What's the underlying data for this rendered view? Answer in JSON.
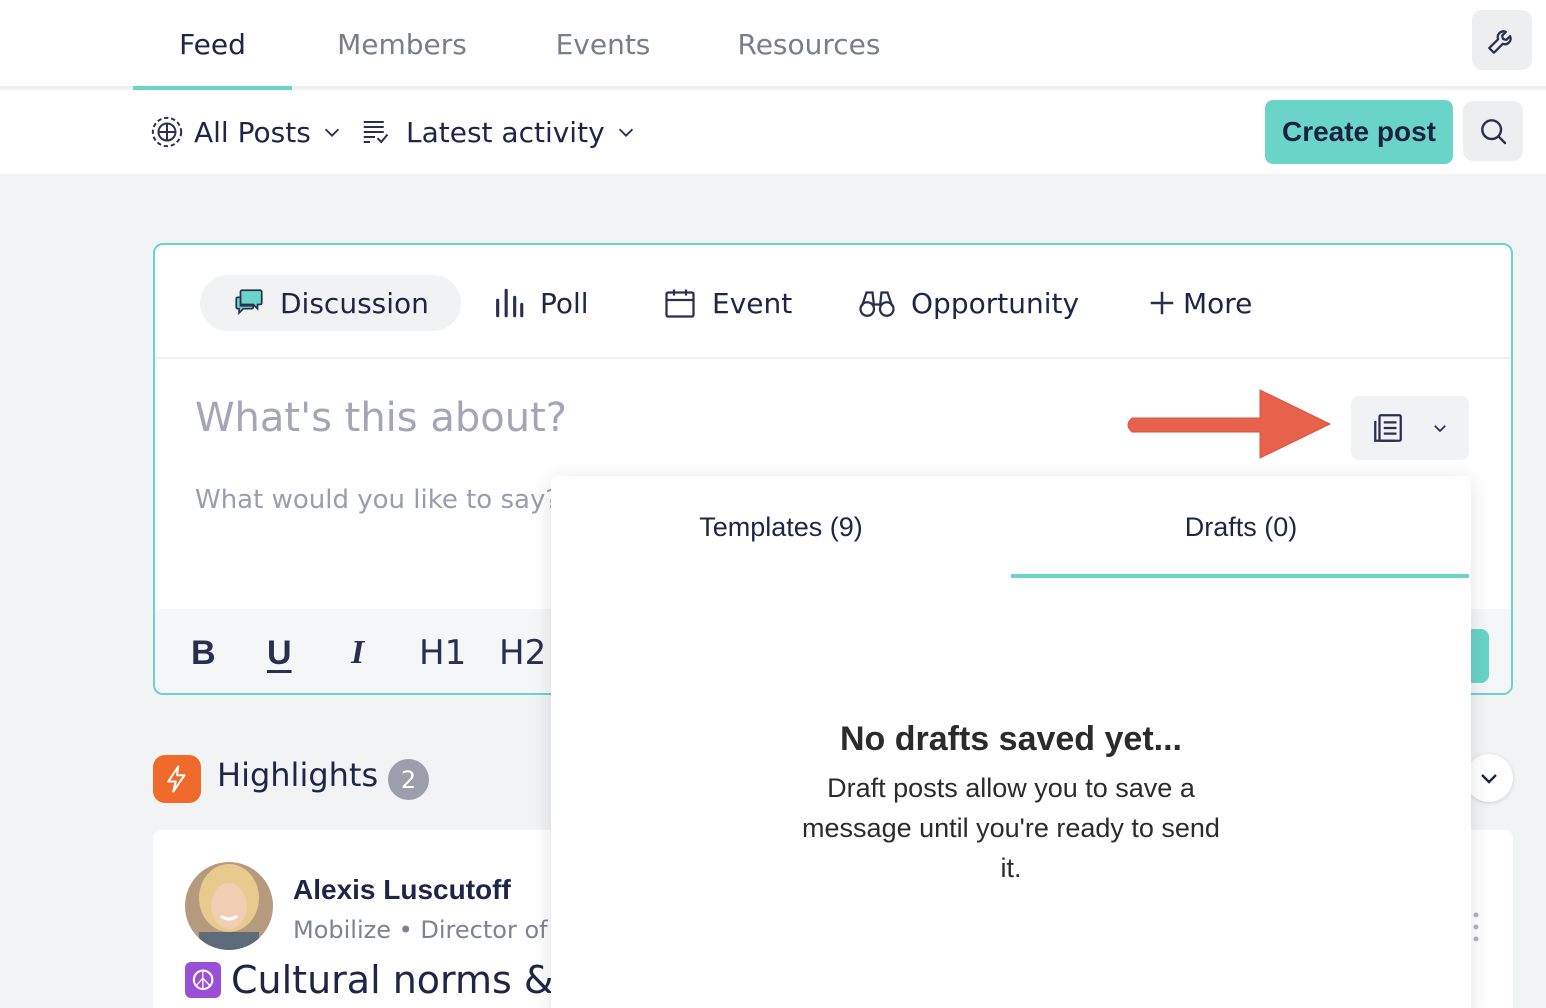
{
  "nav": {
    "tabs": [
      {
        "label": "Feed"
      },
      {
        "label": "Members"
      },
      {
        "label": "Events"
      },
      {
        "label": "Resources"
      }
    ]
  },
  "filters": {
    "scope": "All Posts",
    "sort": "Latest activity",
    "create_label": "Create post"
  },
  "composer": {
    "types": [
      {
        "label": "Discussion"
      },
      {
        "label": "Poll"
      },
      {
        "label": "Event"
      },
      {
        "label": "Opportunity"
      },
      {
        "label": "More"
      }
    ],
    "title_placeholder": "What's this about?",
    "body_placeholder": "What would you like to say?",
    "toolbar": [
      "B",
      "U",
      "I",
      "H1",
      "H2"
    ]
  },
  "dropdown": {
    "tabs": [
      {
        "label": "Templates (9)"
      },
      {
        "label": "Drafts (0)"
      }
    ],
    "empty_title": "No drafts saved yet...",
    "empty_desc": "Draft posts allow you to save a message until you're ready to send it."
  },
  "highlights": {
    "label": "Highlights",
    "count": "2"
  },
  "post": {
    "author": "Alexis Luscutoff",
    "meta": "Mobilize • Director of C",
    "title": "Cultural norms & g"
  },
  "colors": {
    "accent": "#6ad4c8",
    "highlight": "#f06b2b",
    "arrow": "#e8614a"
  }
}
